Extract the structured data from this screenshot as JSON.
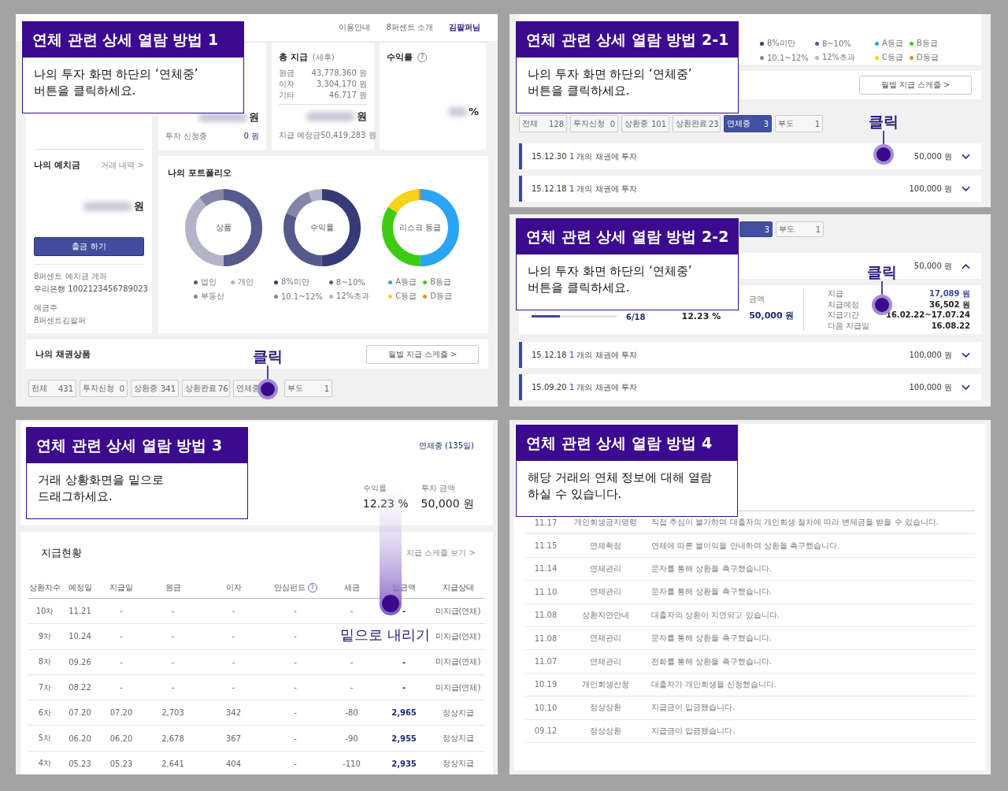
{
  "step1": {
    "callout": {
      "title": "연체 관련 상세 열람 방법 1",
      "lines": [
        "나의 투자 화면 하단의 ‘연체중’",
        "버튼을 클릭하세요."
      ]
    },
    "nav": [
      {
        "label": "이용안내",
        "selected": false
      },
      {
        "label": "8퍼센트 소개",
        "selected": false
      },
      {
        "label": "김팔퍼님",
        "selected": true
      }
    ],
    "invest_card": {
      "unit": "원",
      "pending_label": "투자 신청중",
      "pending_value": "0 원"
    },
    "payout_card": {
      "title": "총 지급",
      "note": "(세후)",
      "rows": [
        {
          "label": "원금",
          "value": "43,778,360 원"
        },
        {
          "label": "이자",
          "value": "3,304,170 원"
        },
        {
          "label": "기타",
          "value": "46,717 원"
        }
      ],
      "unit": "원",
      "expected_label": "지급 예정금",
      "expected_value": "50,419,283 원"
    },
    "return_card": {
      "title": "수익률",
      "hint": "?",
      "unit": "%"
    },
    "deposit": {
      "title": "나의 예치금",
      "link": "거래 내역 >",
      "unit": "원",
      "button": "출금 하기",
      "account_label": "8퍼센트 예치금 계좌",
      "account": "우리은행 1002123456789023",
      "holder_label": "예금주",
      "holder": "8퍼센트김팔퍼"
    },
    "portfolio": {
      "title": "나의 포트폴리오",
      "donuts": [
        {
          "center": "상품",
          "legend": [
            {
              "label": "법인",
              "color": "#545a8c"
            },
            {
              "label": "개인",
              "color": "#b4b4c8"
            },
            {
              "label": "부동산",
              "color": "#8386a6"
            }
          ]
        },
        {
          "center": "수익률",
          "legend": [
            {
              "label": "8%미만",
              "color": "#363a76"
            },
            {
              "label": "8~10%",
              "color": "#545a8c"
            },
            {
              "label": "10.1~12%",
              "color": "#8386a6"
            },
            {
              "label": "12%초과",
              "color": "#b4b4c8"
            }
          ]
        },
        {
          "center": "리스크 등급",
          "legend": [
            {
              "label": "A등급",
              "color": "#2aa4f4"
            },
            {
              "label": "B등급",
              "color": "#3ecb12"
            },
            {
              "label": "C등급",
              "color": "#f8d21a"
            },
            {
              "label": "D등급",
              "color": "#f08c1a"
            }
          ]
        }
      ]
    },
    "bonds": {
      "title": "나의 채권상품",
      "button": "월별 지급 스케줄 >"
    },
    "filters": [
      {
        "label": "전체",
        "count": "431",
        "selected": false
      },
      {
        "label": "투자신청",
        "count": "0",
        "selected": false
      },
      {
        "label": "상환중",
        "count": "341",
        "selected": false
      },
      {
        "label": "상환완료",
        "count": "76",
        "selected": false
      },
      {
        "label": "연체중",
        "selected": false
      },
      {
        "label": "부도",
        "count": "1",
        "selected": false
      }
    ],
    "click": "클릭"
  },
  "step2_1": {
    "callout": {
      "title": "연체 관련 상세 열람 방법 2-1",
      "lines": [
        "나의 투자 화면 하단의 ‘연체중’",
        "버튼을 클릭하세요."
      ]
    },
    "legends": [
      [
        {
          "label": "8%미만",
          "color": "#363a76"
        },
        {
          "label": "8~10%",
          "color": "#545a8c"
        },
        {
          "label": "10.1~12%",
          "color": "#8386a6"
        },
        {
          "label": "12%초과",
          "color": "#b4b4c8"
        }
      ],
      [
        {
          "label": "A등급",
          "color": "#2aa4f4"
        },
        {
          "label": "B등급",
          "color": "#3ecb12"
        },
        {
          "label": "C등급",
          "color": "#f8d21a"
        },
        {
          "label": "D등급",
          "color": "#f08c1a"
        }
      ]
    ],
    "schedule_button": "월별 지급 스케줄 >",
    "filters": [
      {
        "label": "전체",
        "count": "128",
        "selected": false
      },
      {
        "label": "투자신청",
        "count": "0",
        "selected": false
      },
      {
        "label": "상환중",
        "count": "101",
        "selected": false
      },
      {
        "label": "상환완료",
        "count": "23",
        "selected": false
      },
      {
        "label": "연체중",
        "count": "3",
        "selected": true
      },
      {
        "label": "부도",
        "count": "1",
        "selected": false
      }
    ],
    "investments": [
      {
        "date": "15.12.30",
        "count": "1",
        "text": "개의 채권에 투자",
        "amount": "50,000 원",
        "expanded": false
      },
      {
        "date": "15.12.18",
        "count": "1",
        "text": "개의 채권에 투자",
        "amount": "100,000 원",
        "expanded": false
      }
    ],
    "click": "클릭"
  },
  "step2_2": {
    "callout": {
      "title": "연체 관련 상세 열람 방법 2-2",
      "lines": [
        "나의 투자 화면 하단의 ‘연체중’",
        "버튼을 클릭하세요."
      ]
    },
    "filters": [
      {
        "count": "3",
        "selected": true
      },
      {
        "label": "부도",
        "count": "1",
        "selected": false
      }
    ],
    "open_investment": {
      "amount": "50,000 원",
      "expanded": true,
      "level": 0.33,
      "progress": "6/18",
      "rate": "12.23 %",
      "amount_label": "금액",
      "invested": "50,000 원",
      "details": [
        {
          "label": "지급",
          "value": "17,089 원",
          "kind": "paid"
        },
        {
          "label": "지급예정",
          "value": "36,502 원",
          "kind": "plain"
        },
        {
          "label": "지급기간",
          "value": "16.02.22~17.07.24",
          "kind": "plain"
        },
        {
          "label": "다음 지급일",
          "value": "16.08.22",
          "kind": "plain"
        }
      ]
    },
    "investments": [
      {
        "date": "15.12.18",
        "count": "1",
        "text": "개의 채권에 투자",
        "amount": "100,000 원",
        "expanded": false
      },
      {
        "date": "15.09.20",
        "count": "1",
        "text": "개의 채권에 투자",
        "amount": "100,000 원",
        "expanded": false
      }
    ],
    "click": "클릭"
  },
  "step3": {
    "callout": {
      "title": "연체 관련 상세 열람 방법 3",
      "lines": [
        "거래 상황화면을 밑으로",
        "드래그하세요."
      ]
    },
    "status": "연체중 (135일)",
    "stats": [
      {
        "label": "수익률",
        "value": "12.23 %"
      },
      {
        "label": "투자 금액",
        "value": "50,000 원"
      }
    ],
    "section_title": "지급현황",
    "schedule_link": "지급 스케줄 보기 >",
    "columns": [
      {
        "label": "상환차수"
      },
      {
        "label": "예정일"
      },
      {
        "label": "지급일"
      },
      {
        "label": "원금"
      },
      {
        "label": "이자"
      },
      {
        "label": "안심펀드",
        "hint": "?"
      },
      {
        "label": "세금"
      },
      {
        "label": "입금액"
      },
      {
        "label": "지급상태"
      }
    ],
    "rows": [
      {
        "round": "10차",
        "due": "11.21",
        "paid": "-",
        "principal": "-",
        "interest": "-",
        "fund": "-",
        "tax": "-",
        "deposit": "-",
        "status": "미지급(연체)"
      },
      {
        "round": "9차",
        "due": "10.24",
        "paid": "-",
        "principal": "-",
        "interest": "-",
        "fund": "-",
        "status": "미지급(연체)"
      },
      {
        "round": "8차",
        "due": "09.26",
        "paid": "-",
        "principal": "-",
        "interest": "-",
        "fund": "-",
        "tax": "-",
        "deposit": "-",
        "status": "미지급(연체)"
      },
      {
        "round": "7차",
        "due": "08.22",
        "paid": "-",
        "principal": "-",
        "interest": "-",
        "fund": "-",
        "tax": "-",
        "deposit": "-",
        "status": "미지급(연체)"
      },
      {
        "round": "6차",
        "due": "07.20",
        "paid": "07.20",
        "principal": "2,703",
        "interest": "342",
        "fund": "-",
        "tax": "-80",
        "deposit": "2,965",
        "status": "정상지급"
      },
      {
        "round": "5차",
        "due": "06.20",
        "paid": "06.20",
        "principal": "2,678",
        "interest": "367",
        "fund": "-",
        "tax": "-90",
        "deposit": "2,955",
        "status": "정상지급"
      },
      {
        "round": "4차",
        "due": "05.23",
        "paid": "05.23",
        "principal": "2,641",
        "interest": "404",
        "fund": "-",
        "tax": "-110",
        "deposit": "2,935",
        "status": "정상지급"
      }
    ],
    "drag_label": "밑으로 내리기"
  },
  "step4": {
    "callout": {
      "title": "연체 관련 상세 열람 방법 4",
      "lines": [
        "해당 거래의 연체 정보에 대해 열람",
        "하실 수 있습니다."
      ]
    },
    "log": [
      {
        "date": "11.17",
        "type": "개인회생금지명령",
        "message": "직접 추심이 불가하며 대출자의 개인회생 절차에 따라 변제금을 받을 수 있습니다."
      },
      {
        "date": "11.15",
        "type": "연체확정",
        "message": "연체에 따른 불이익을 안내하며 상환을 촉구했습니다."
      },
      {
        "date": "11.14",
        "type": "연체관리",
        "message": "문자를 통해 상환을 촉구했습니다."
      },
      {
        "date": "11.10",
        "type": "연체관리",
        "message": "문자를 통해 상환을 촉구했습니다."
      },
      {
        "date": "11.08",
        "type": "상환지연안내",
        "message": "대출자의 상환이 지연되고 있습니다."
      },
      {
        "date": "11.08",
        "type": "연체관리",
        "message": "문자를 통해 상환을 촉구했습니다."
      },
      {
        "date": "11.07",
        "type": "연체관리",
        "message": "전화를 통해 상환을 촉구했습니다."
      },
      {
        "date": "10.19",
        "type": "개인회생신청",
        "message": "대출자가 개인회생을 신청했습니다."
      },
      {
        "date": "10.10",
        "type": "정상상환",
        "message": "지급금이 입금됐습니다."
      },
      {
        "date": "09.12",
        "type": "정상상환",
        "message": "지급금이 입금됐습니다."
      }
    ]
  }
}
